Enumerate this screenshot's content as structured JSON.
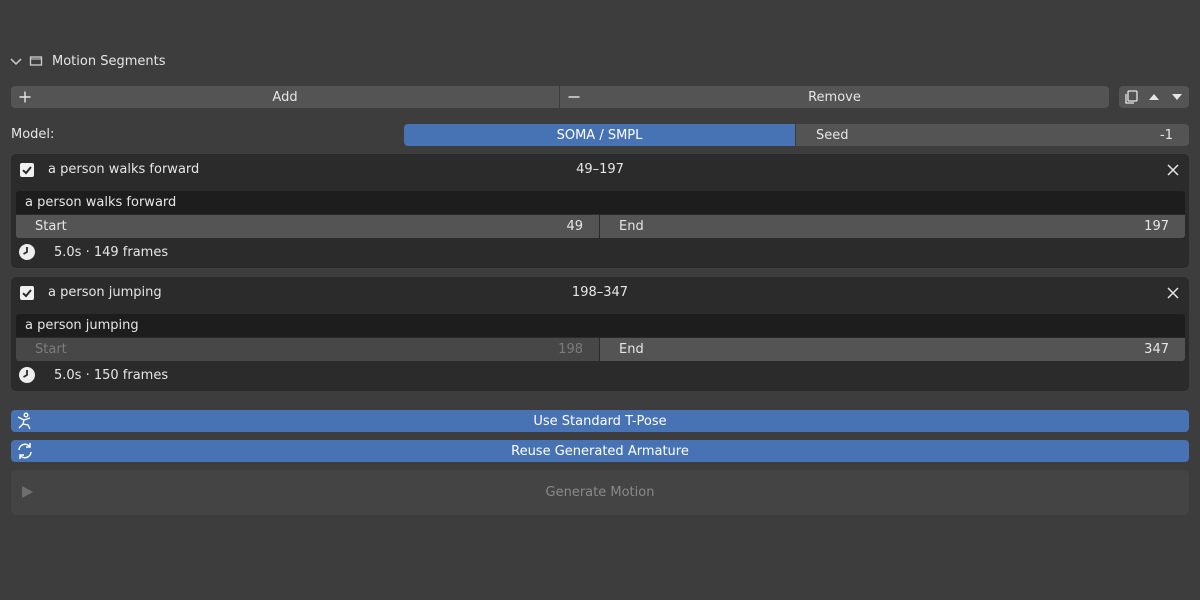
{
  "panel": {
    "title": "Motion Segments"
  },
  "toolbar": {
    "add_label": "Add",
    "remove_label": "Remove"
  },
  "model": {
    "label": "Model:",
    "selected": "SOMA / SMPL"
  },
  "seed": {
    "label": "Seed",
    "value": "-1"
  },
  "segments": [
    {
      "enabled": true,
      "title": "a person walks forward",
      "range": "49–197",
      "prompt": "a person walks forward",
      "start_label": "Start",
      "start_value": "49",
      "end_label": "End",
      "end_value": "197",
      "duration": "5.0s · 149 frames",
      "start_disabled": false
    },
    {
      "enabled": true,
      "title": "a person jumping",
      "range": "198–347",
      "prompt": "a person jumping",
      "start_label": "Start",
      "start_value": "198",
      "end_label": "End",
      "end_value": "347",
      "duration": "5.0s · 150 frames",
      "start_disabled": true
    }
  ],
  "buttons": {
    "tpose": "Use Standard T-Pose",
    "reuse": "Reuse Generated Armature",
    "generate": "Generate Motion"
  },
  "colors": {
    "background": "#3d3d3d",
    "accent": "#4772b3",
    "card": "#2b2b2b",
    "field": "#545454",
    "text_field": "#1d1d1d"
  }
}
